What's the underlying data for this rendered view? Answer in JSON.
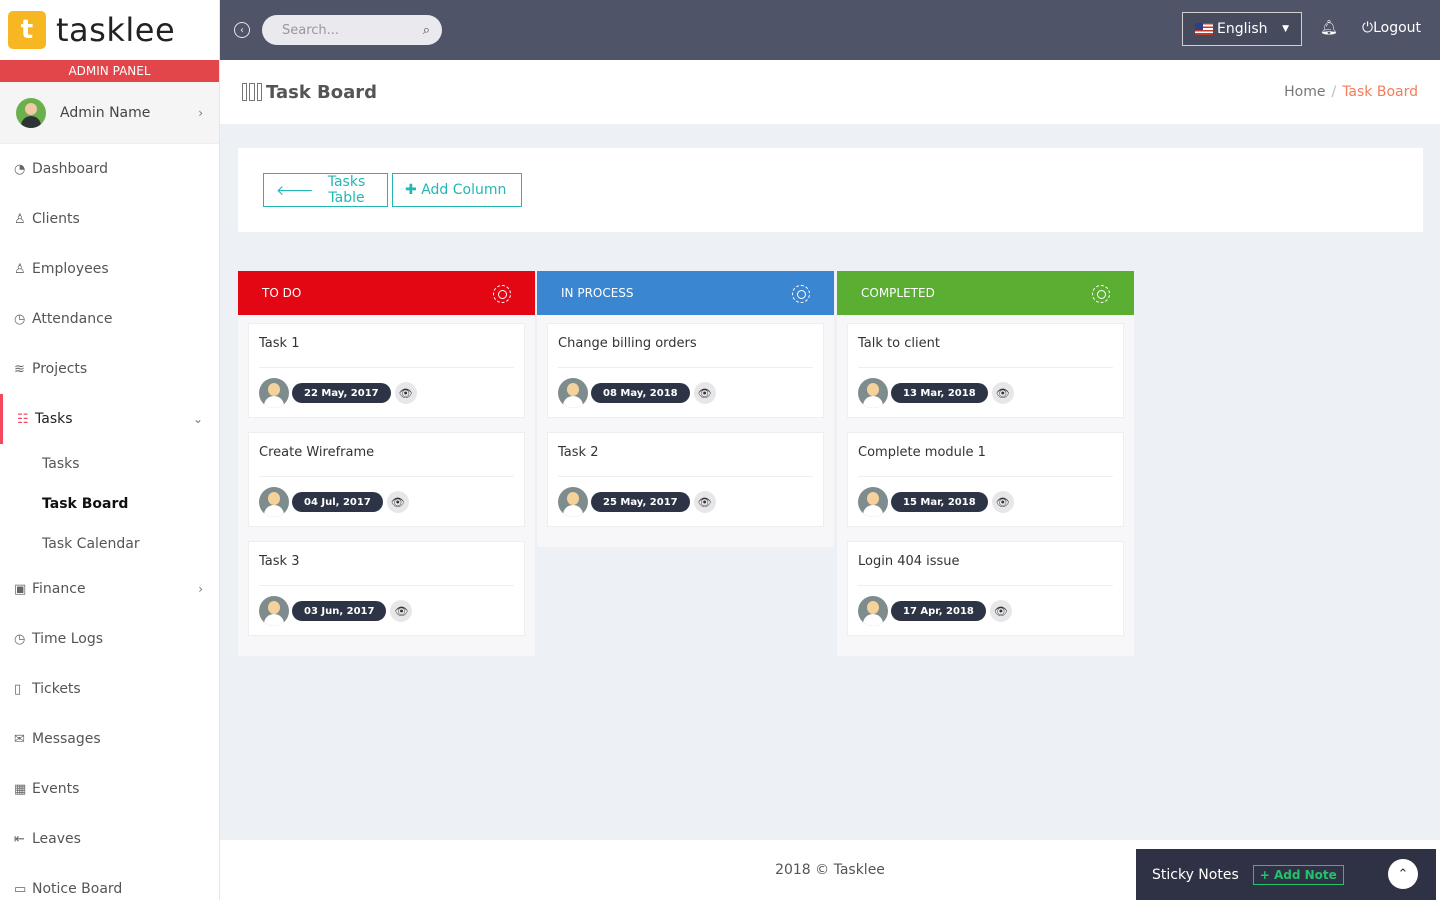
{
  "brand": {
    "letter": "t",
    "name": "tasklee"
  },
  "sidebar": {
    "panel_label": "ADMIN PANEL",
    "profile_name": "Admin Name",
    "items": [
      {
        "label": "Dashboard",
        "icon": "dashboard-icon"
      },
      {
        "label": "Clients",
        "icon": "clients-icon"
      },
      {
        "label": "Employees",
        "icon": "employees-icon"
      },
      {
        "label": "Attendance",
        "icon": "clock-icon"
      },
      {
        "label": "Projects",
        "icon": "layers-icon"
      },
      {
        "label": "Tasks",
        "icon": "list-icon"
      },
      {
        "label": "Finance",
        "icon": "money-icon"
      },
      {
        "label": "Time Logs",
        "icon": "clock-icon"
      },
      {
        "label": "Tickets",
        "icon": "ticket-icon"
      },
      {
        "label": "Messages",
        "icon": "envelope-icon"
      },
      {
        "label": "Events",
        "icon": "calendar-icon"
      },
      {
        "label": "Leaves",
        "icon": "logout-icon"
      },
      {
        "label": "Notice Board",
        "icon": "laptop-icon"
      }
    ],
    "subitems": [
      {
        "label": "Tasks"
      },
      {
        "label": "Task Board"
      },
      {
        "label": "Task Calendar"
      }
    ]
  },
  "topbar": {
    "search_placeholder": "Search...",
    "language": "English",
    "logout": "Logout"
  },
  "page": {
    "title": "Task Board",
    "breadcrumb": [
      "Home",
      "Task Board"
    ]
  },
  "actions": {
    "tasks_table": "Tasks Table",
    "add_column": "Add Column"
  },
  "board": {
    "columns": [
      {
        "title": "TO DO",
        "color": "#e30613",
        "cards": [
          {
            "title": "Task 1",
            "date": "22 May, 2017"
          },
          {
            "title": "Create Wireframe",
            "date": "04 Jul, 2017"
          },
          {
            "title": "Task 3",
            "date": "03 Jun, 2017"
          }
        ]
      },
      {
        "title": "IN PROCESS",
        "color": "#3b86d1",
        "cards": [
          {
            "title": "Change billing orders",
            "date": "08 May, 2018"
          },
          {
            "title": "Task 2",
            "date": "25 May, 2017"
          }
        ]
      },
      {
        "title": "COMPLETED",
        "color": "#5aae32",
        "cards": [
          {
            "title": "Talk to client",
            "date": "13 Mar, 2018"
          },
          {
            "title": "Complete module 1",
            "date": "15 Mar, 2018"
          },
          {
            "title": "Login 404 issue",
            "date": "17 Apr, 2018"
          }
        ]
      }
    ]
  },
  "footer": {
    "text": "2018 © Tasklee"
  },
  "sticky_notes": {
    "title": "Sticky Notes",
    "add_label": "Add Note"
  }
}
